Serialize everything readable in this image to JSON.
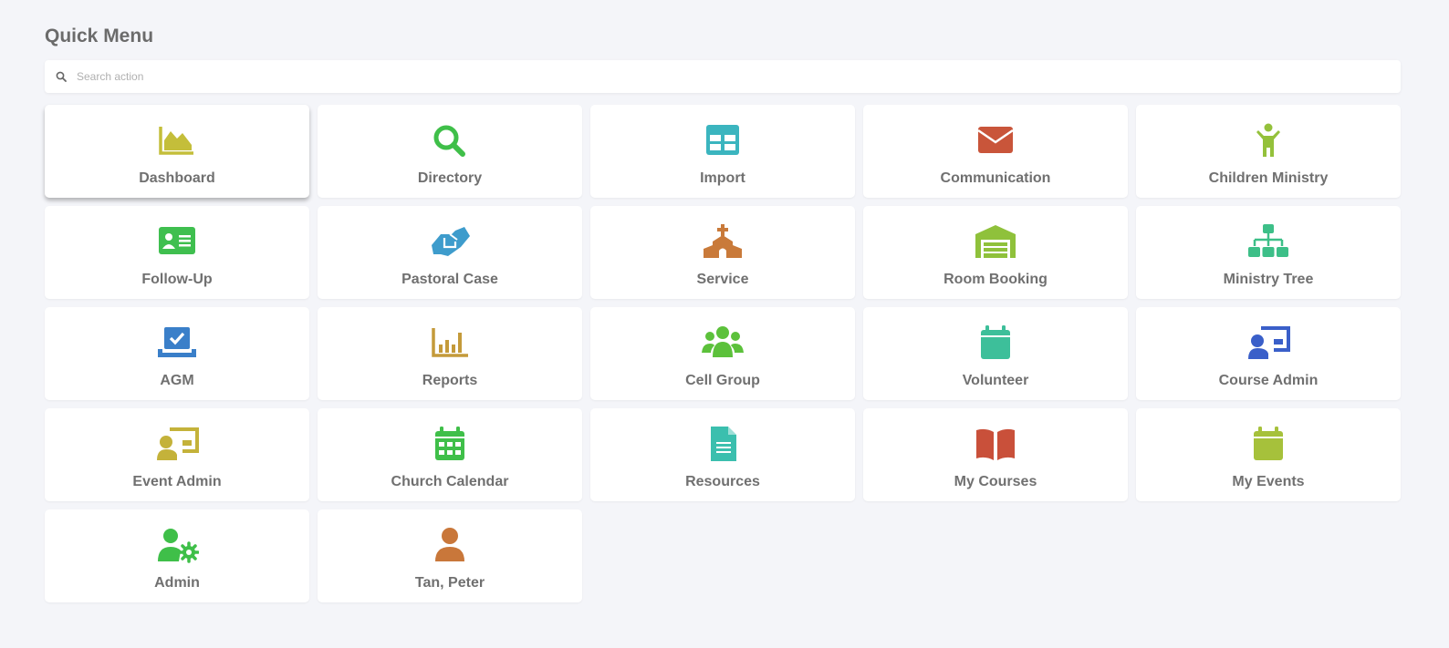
{
  "header": {
    "title": "Quick Menu"
  },
  "search": {
    "placeholder": "Search action",
    "value": ""
  },
  "menu": [
    {
      "label": "Dashboard",
      "icon": "chart-area-icon",
      "color": "#c4be3a"
    },
    {
      "label": "Directory",
      "icon": "search-icon",
      "color": "#3fbf49"
    },
    {
      "label": "Import",
      "icon": "table-icon",
      "color": "#3bb5bf"
    },
    {
      "label": "Communication",
      "icon": "envelope-icon",
      "color": "#c9553a"
    },
    {
      "label": "Children Ministry",
      "icon": "child-icon",
      "color": "#94c13b"
    },
    {
      "label": "Follow-Up",
      "icon": "id-card-icon",
      "color": "#3fbf4f"
    },
    {
      "label": "Pastoral Case",
      "icon": "handshake-icon",
      "color": "#3e9ccc"
    },
    {
      "label": "Service",
      "icon": "church-icon",
      "color": "#c97a3a"
    },
    {
      "label": "Room Booking",
      "icon": "warehouse-icon",
      "color": "#8fc13b"
    },
    {
      "label": "Ministry Tree",
      "icon": "sitemap-icon",
      "color": "#3dbf88"
    },
    {
      "label": "AGM",
      "icon": "laptop-check-icon",
      "color": "#3a7fc9"
    },
    {
      "label": "Reports",
      "icon": "chart-bar-icon",
      "color": "#c49a3a"
    },
    {
      "label": "Cell Group",
      "icon": "users-icon",
      "color": "#5cc13b"
    },
    {
      "label": "Volunteer",
      "icon": "calendar-icon",
      "color": "#3dbf9a"
    },
    {
      "label": "Course Admin",
      "icon": "teacher-icon",
      "color": "#3a5fc9"
    },
    {
      "label": "Event Admin",
      "icon": "teacher-icon",
      "color": "#c4b23a"
    },
    {
      "label": "Church Calendar",
      "icon": "calendar-grid-icon",
      "color": "#3fbf49"
    },
    {
      "label": "Resources",
      "icon": "file-icon",
      "color": "#3bbfae"
    },
    {
      "label": "My Courses",
      "icon": "book-open-icon",
      "color": "#c9503a"
    },
    {
      "label": "My Events",
      "icon": "calendar-icon",
      "color": "#a6c13b"
    },
    {
      "label": "Admin",
      "icon": "user-cog-icon",
      "color": "#3fbf49"
    },
    {
      "label": "Tan, Peter",
      "icon": "user-icon",
      "color": "#c9773a"
    }
  ],
  "active_item": "Dashboard"
}
